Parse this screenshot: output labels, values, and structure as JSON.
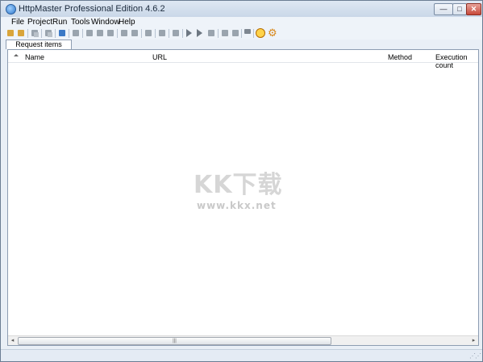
{
  "window": {
    "title": "HttpMaster Professional Edition 4.6.2",
    "min_label": "—",
    "max_label": "□",
    "close_label": "✕"
  },
  "menu": [
    "File",
    "Project",
    "Run",
    "Tools",
    "Window",
    "Help"
  ],
  "tabs": [
    {
      "label": "Request items",
      "active": true
    }
  ],
  "table": {
    "columns": [
      "Name",
      "URL",
      "Method",
      "Execution count"
    ],
    "rows": []
  },
  "scrollbar": {
    "left": "◂",
    "right": "▸",
    "grip": "|||"
  },
  "watermark": {
    "title": "KK下载",
    "url": "www.kkx.net"
  },
  "toolbar_icons": [
    "add-request-icon",
    "add-folder-icon",
    "copy-icon",
    "paste-icon",
    "import-icon",
    "settings-icon",
    "move-up-icon",
    "move-down-icon",
    "move-left-icon",
    "move-right-icon",
    "indent-icon",
    "outdent-icon",
    "list-icon",
    "run-selected-icon",
    "link-icon",
    "play-icon",
    "fast-forward-icon",
    "run-to-icon",
    "validate-icon",
    "validate-all-icon",
    "lock-icon",
    "execute-circle-icon",
    "gear-icon"
  ],
  "status": {
    "grip": "⋰⋰"
  },
  "colors": {
    "accent": "#3b79c6",
    "title_bar": "#c9d7e8",
    "gear": "#d8871a"
  }
}
